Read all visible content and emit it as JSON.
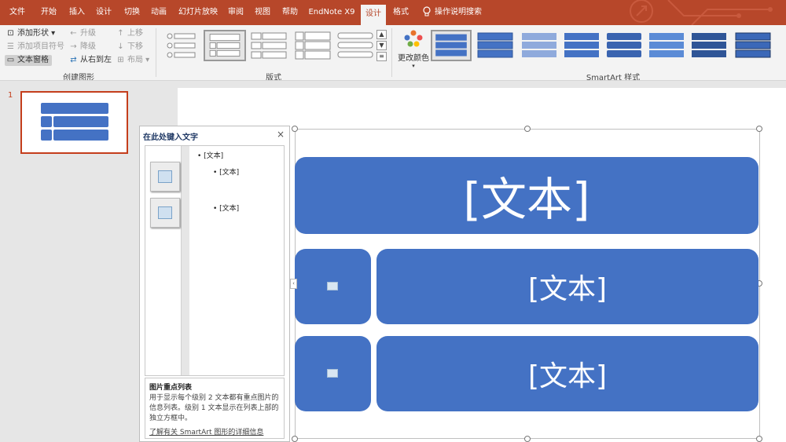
{
  "tabs": [
    "文件",
    "开始",
    "插入",
    "设计",
    "切换",
    "动画",
    "幻灯片放映",
    "审阅",
    "视图",
    "帮助",
    "EndNote X9",
    "设计",
    "格式"
  ],
  "search": {
    "label": "操作说明搜索",
    "icon": "lightbulb-icon"
  },
  "ribbon": {
    "create": {
      "add_shape": "添加形状",
      "add_bullet": "添加项目符号",
      "text_pane": "文本窗格",
      "promote": "升级",
      "demote": "降级",
      "right_to_left": "从右到左",
      "move_up": "上移",
      "move_down": "下移",
      "layout": "布局",
      "group_label": "创建图形"
    },
    "layouts_label": "版式",
    "change_colors": "更改颜色",
    "styles_label": "SmartArt 样式"
  },
  "thumbnail": {
    "slide_number": "1"
  },
  "text_pane": {
    "title": "在此处键入文字",
    "close": "×",
    "bullets": [
      "[文本]",
      "[文本]",
      "[文本]"
    ],
    "desc_title": "图片重点列表",
    "desc_body": "用于显示每个级别 2 文本都有重点图片的信息列表。级别 1 文本显示在列表上部的独立方框中。",
    "link": "了解有关 SmartArt 图形的详细信息"
  },
  "smartart": {
    "top_text": "[文本]",
    "row1_text": "[文本]",
    "row2_text": "[文本]",
    "color": "#4472c4"
  },
  "colors": {
    "accent": "#b7472a",
    "smartart": "#4472c4",
    "selected_border": "#c43e1c"
  }
}
